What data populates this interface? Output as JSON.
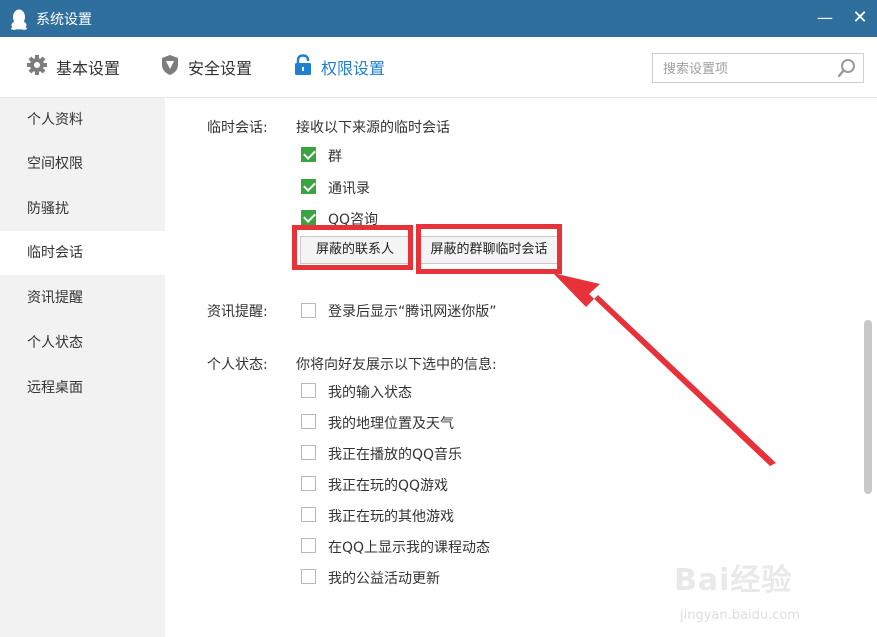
{
  "window": {
    "title": "系统设置",
    "minimize": "—",
    "close": "✕"
  },
  "tabs": [
    {
      "label": "基本设置",
      "icon": "gear-icon"
    },
    {
      "label": "安全设置",
      "icon": "shield-icon"
    },
    {
      "label": "权限设置",
      "icon": "lock-icon",
      "active": true
    }
  ],
  "search": {
    "placeholder": "搜索设置项"
  },
  "sidebar": {
    "items": [
      {
        "label": "个人资料"
      },
      {
        "label": "空间权限"
      },
      {
        "label": "防骚扰"
      },
      {
        "label": "临时会话",
        "active": true
      },
      {
        "label": "资讯提醒"
      },
      {
        "label": "个人状态"
      },
      {
        "label": "远程桌面"
      }
    ]
  },
  "temp_chat": {
    "label": "临时会话:",
    "desc": "接收以下来源的临时会话",
    "options": [
      {
        "label": "群",
        "checked": true
      },
      {
        "label": "通讯录",
        "checked": true
      },
      {
        "label": "QQ咨询",
        "checked": true
      }
    ],
    "btn_blocked_contacts": "屏蔽的联系人",
    "btn_blocked_groups": "屏蔽的群聊临时会话"
  },
  "news": {
    "label": "资讯提醒:",
    "option": {
      "label": "登录后显示“腾讯网迷你版”",
      "checked": false
    }
  },
  "status": {
    "label": "个人状态:",
    "desc": "你将向好友展示以下选中的信息:",
    "options": [
      {
        "label": "我的输入状态",
        "checked": false
      },
      {
        "label": "我的地理位置及天气",
        "checked": false
      },
      {
        "label": "我正在播放的QQ音乐",
        "checked": false
      },
      {
        "label": "我正在玩的QQ游戏",
        "checked": false
      },
      {
        "label": "我正在玩的其他游戏",
        "checked": false
      },
      {
        "label": "在QQ上显示我的课程动态",
        "checked": false
      },
      {
        "label": "我的公益活动更新",
        "checked": false
      }
    ]
  },
  "watermark": {
    "brand": "Bai经验",
    "url": "jingyan.baidu.com"
  },
  "colors": {
    "titlebar": "#2f6f9e",
    "accent": "#1f7fd0",
    "check": "#3aa53f",
    "highlight": "#e8323a"
  }
}
